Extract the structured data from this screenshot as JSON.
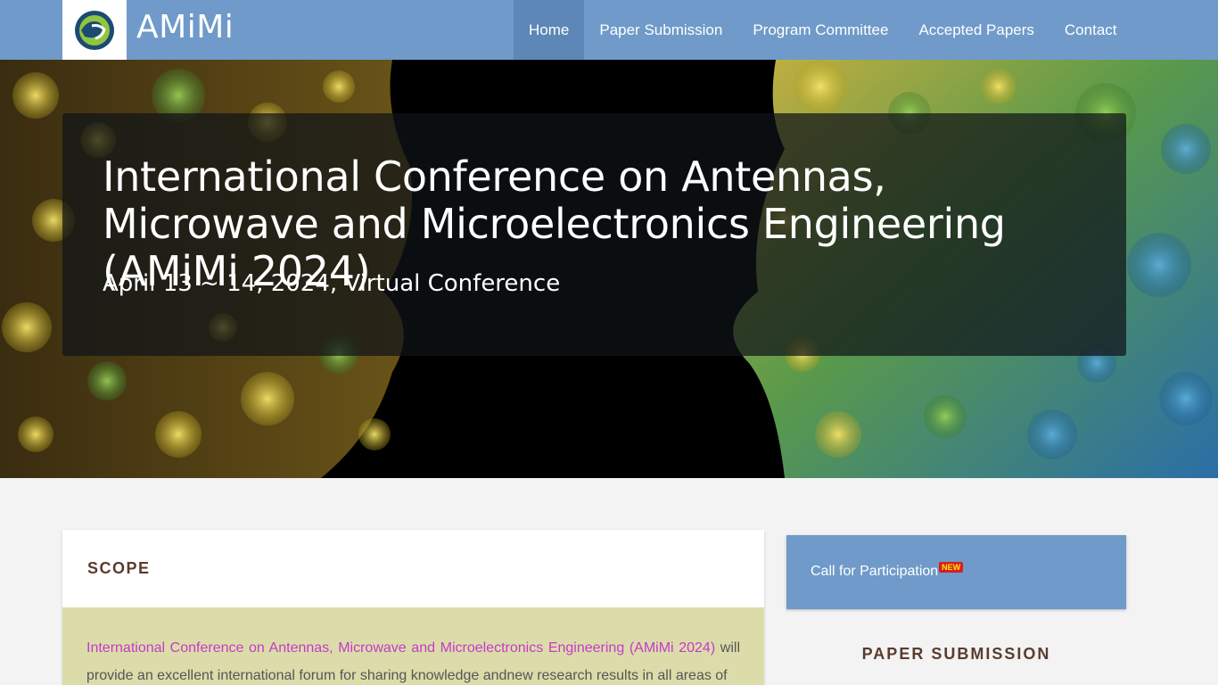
{
  "navbar": {
    "brand": "AMiMi",
    "items": [
      {
        "label": "Home",
        "active": true
      },
      {
        "label": "Paper Submission",
        "active": false
      },
      {
        "label": "Program Committee",
        "active": false
      },
      {
        "label": "Accepted Papers",
        "active": false
      },
      {
        "label": "Contact",
        "active": false
      }
    ],
    "bg_color": "#6f9ac9",
    "active_color": "#5d87b6"
  },
  "hero": {
    "title": "International Conference on Antennas, Microwave and Microelectronics Engineering (AMiMi 2024)",
    "subtitle": "April 13 ~ 14, 2024, Virtual Conference"
  },
  "scope": {
    "heading": "SCOPE",
    "link_text": "International Conference on Antennas, Microwave and Microelectronics Engineering (AMiMi 2024)",
    "body_text": " will provide an excellent international forum for sharing knowledge andnew research results in all areas of",
    "link_color": "#c63ac9",
    "body_bg": "#dcdcaa"
  },
  "sidebar": {
    "cfp_label": "Call for Participation",
    "new_badge": "NEW",
    "paper_submission_heading": "PAPER SUBMISSION"
  }
}
